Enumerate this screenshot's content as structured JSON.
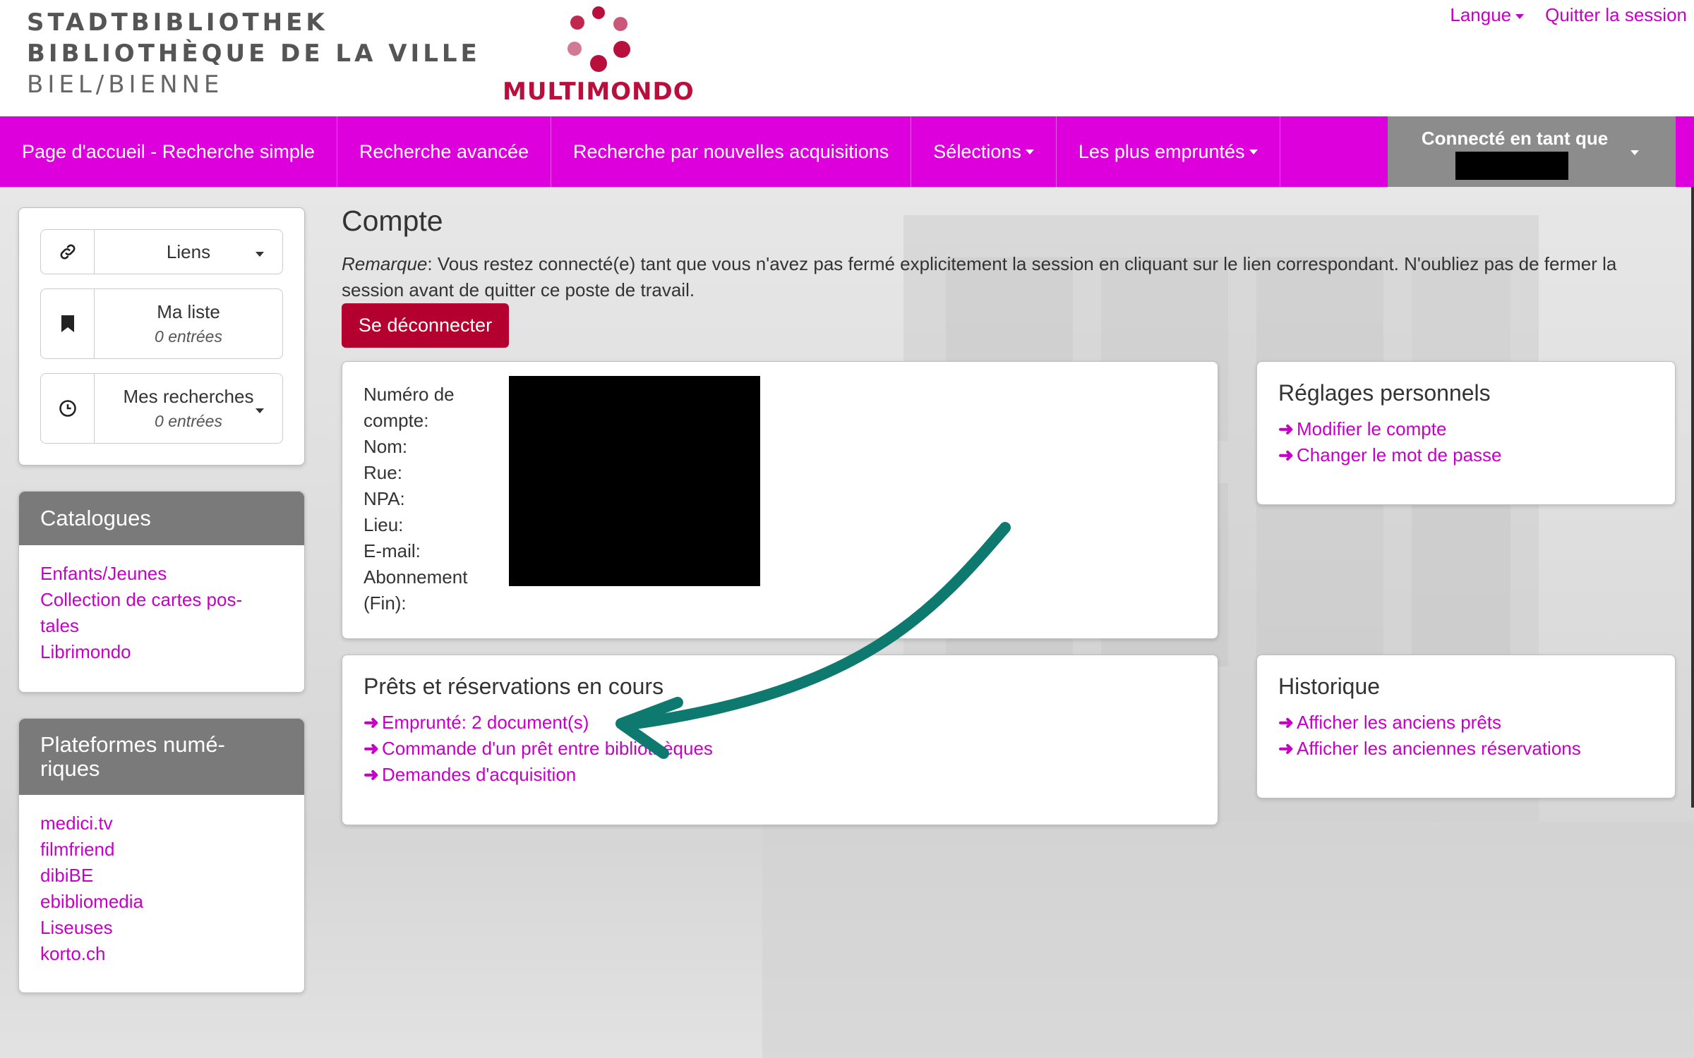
{
  "header": {
    "library_lines": [
      "STADTBIBLIOTHEK",
      "BIBLIOTHÈQUE DE LA VILLE",
      "BIEL/BIENNE"
    ],
    "logo_text": "MULTIMONDO",
    "logo_color": "#b80f3c",
    "top_links": {
      "language": "Langue",
      "logout": "Quitter la session"
    }
  },
  "navbar": {
    "background": "#dd00dd",
    "items": [
      {
        "label": "Page d'accueil - Recherche simple",
        "dropdown": false
      },
      {
        "label": "Recherche avancée",
        "dropdown": false
      },
      {
        "label": "Recherche par nouvelles acquisitions",
        "dropdown": false
      },
      {
        "label": "Sélections",
        "dropdown": true
      },
      {
        "label": "Les plus empruntés",
        "dropdown": true
      }
    ],
    "user_label": "Connecté en tant que"
  },
  "sidebar": {
    "links_button": {
      "label": "Liens",
      "icon": "link-icon"
    },
    "my_list": {
      "label": "Ma liste",
      "count": "0 entrées",
      "icon": "bookmark-icon"
    },
    "my_searches": {
      "label": "Mes recherches",
      "count": "0 entrées",
      "icon": "clock-icon"
    },
    "catalogues": {
      "title": "Catalogues",
      "items": [
        "Enfants/Jeunes",
        "Collection de cartes pos-",
        "tales",
        "Librimondo"
      ]
    },
    "platforms": {
      "title_line1": "Plateformes numé-",
      "title_line2": "riques",
      "items": [
        "medici.tv",
        "filmfriend",
        "dibiBE",
        "ebibliomedia",
        "Liseuses",
        "korto.ch"
      ]
    }
  },
  "main": {
    "title": "Compte",
    "remark_label": "Remarque",
    "remark_text": ": Vous restez connecté(e) tant que vous n'avez pas fermé explicitement la session en cliquant sur le lien correspondant. N'oubliez pas de fermer la session avant de quitter ce poste de travail.",
    "logout_button": "Se déconnecter",
    "account_labels": [
      "Numéro de",
      "compte:",
      "Nom:",
      "Rue:",
      "NPA:",
      "Lieu:",
      "E-mail:",
      "Abonnement",
      "(Fin):"
    ],
    "settings": {
      "title": "Réglages personnels",
      "links": [
        "Modifier le compte",
        "Changer le mot de passe"
      ]
    },
    "loans": {
      "title": "Prêts et réservations en cours",
      "links": [
        "Emprunté: 2 document(s)",
        "Commande d'un prêt entre bibliothèques",
        "Demandes d'acquisition"
      ]
    },
    "history": {
      "title": "Historique",
      "links": [
        "Afficher les anciens prêts",
        "Afficher les anciennes réservations"
      ]
    }
  },
  "colors": {
    "link": "#c700c7",
    "logout_button": "#b3002e",
    "box_header": "#7a7a7a",
    "annotation_arrow": "#0e7a6f"
  }
}
